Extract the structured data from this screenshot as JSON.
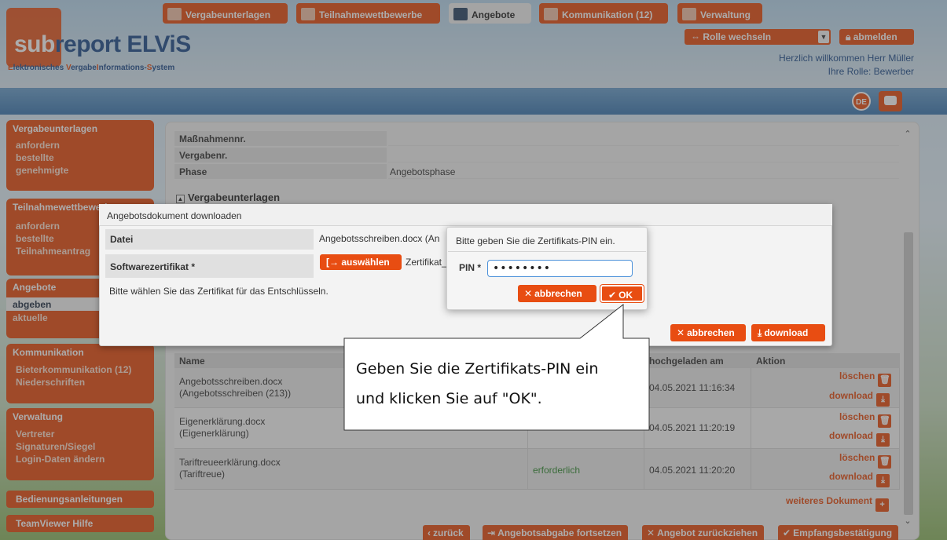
{
  "header": {
    "logo_sub": "sub",
    "logo_rest": "report ELViS",
    "tagline_parts": [
      "E",
      "lektronisches ",
      "V",
      "ergabe",
      "I",
      "nformations-",
      "S",
      "ystem"
    ],
    "role_switch_label": "⇔ Rolle wechseln",
    "logout_label": "abmelden",
    "welcome": "Herzlich willkommen Herr Müller",
    "role_line": "Ihre Rolle: Bewerber"
  },
  "nav": {
    "tabs": [
      {
        "label": "Vergabeunterlagen",
        "icon": "document-icon"
      },
      {
        "label": "Teilnahmewettbewerbe",
        "icon": "document-icon"
      },
      {
        "label": "Angebote",
        "icon": "envelope-icon",
        "active": true
      },
      {
        "label": "Kommunikation (12)",
        "icon": "person-icon"
      },
      {
        "label": "Verwaltung",
        "icon": "calendar-icon"
      }
    ],
    "lang_label": "DE"
  },
  "sidebar": {
    "groups": [
      {
        "title": "Vergabeunterlagen",
        "items": [
          "anfordern",
          "bestellte",
          "genehmigte"
        ]
      },
      {
        "title": "Teilnahmewettbewerbe",
        "items": [
          "anfordern",
          "bestellte",
          "Teilnahmeantrag"
        ]
      },
      {
        "title": "Angebote",
        "items": [
          "abgeben",
          "aktuelle"
        ],
        "selected": "abgeben"
      },
      {
        "title": "Kommunikation",
        "items": [
          "Bieterkommunikation (12)",
          "Niederschriften"
        ]
      },
      {
        "title": "Verwaltung",
        "items": [
          "Vertreter",
          "Signaturen/Siegel",
          "Login-Daten ändern"
        ]
      }
    ],
    "manuals": "Bedienungsanleitungen",
    "teamviewer": "TeamViewer Hilfe"
  },
  "main": {
    "fields": [
      {
        "label": "Maßnahmennr.",
        "value": ""
      },
      {
        "label": "Vergabenr.",
        "value": ""
      },
      {
        "label": "Phase",
        "value": "Angebotsphase"
      }
    ],
    "section_title": "Vergabeunterlagen",
    "table": {
      "headers": [
        "Name",
        "hochgeladen am",
        "Aktion"
      ],
      "rows": [
        {
          "name1": "Angebotsschreiben.docx",
          "name2": "(Angebotsschreiben (213))",
          "status": "",
          "date": "04.05.2021 11:16:34"
        },
        {
          "name1": "Eigenerklärung.docx",
          "name2": "(Eigenerklärung)",
          "status": "",
          "date": "04.05.2021 11:20:19"
        },
        {
          "name1": "Tariftreueerklärung.docx",
          "name2": "(Tariftreue)",
          "status": "erforderlich",
          "date": "04.05.2021 11:20:20"
        }
      ],
      "delete_label": "löschen",
      "download_label": "download"
    },
    "add_document": "weiteres Dokument",
    "bottom_buttons": [
      "zurück",
      "Angebotsabgabe fortsetzen",
      "Angebot zurückziehen",
      "Empfangsbestätigung"
    ]
  },
  "download_dialog": {
    "title": "Angebotsdokument downloaden",
    "file_label": "Datei",
    "file_value": "Angebotsschreiben.docx (An",
    "cert_label": "Softwarezertifikat *",
    "select_button": "auswählen",
    "cert_value": "Zertifikat_",
    "hint": "Bitte wählen Sie das Zertifikat für das Entschlüsseln.",
    "cancel": "abbrechen",
    "download": "download"
  },
  "pin_dialog": {
    "title": "Bitte geben Sie die Zertifikats-PIN ein.",
    "pin_label": "PIN *",
    "pin_value": "••••••••",
    "cancel": "abbrechen",
    "ok": "OK"
  },
  "callout": {
    "line1": "Geben Sie die Zertifikats-PIN ein",
    "line2": "und klicken Sie auf \"OK\"."
  }
}
